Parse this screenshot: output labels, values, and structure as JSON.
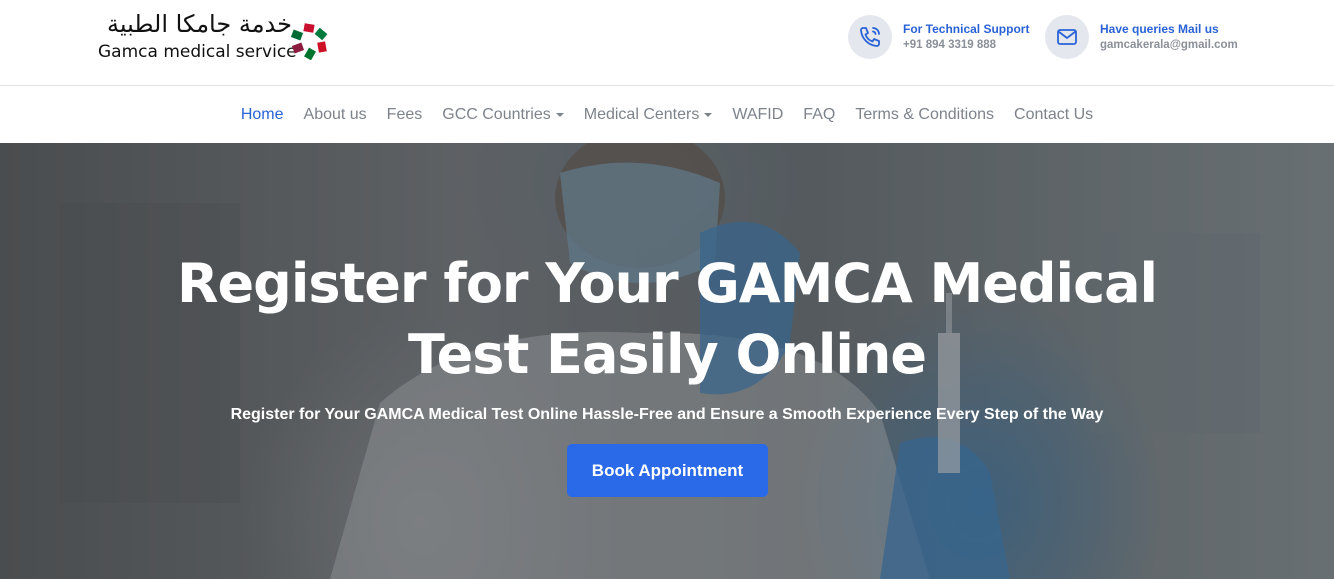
{
  "logo": {
    "arabic": "خدمة جامكا الطبية",
    "english": "Gamca medical service"
  },
  "contacts": {
    "phone": {
      "label": "For Technical Support",
      "value": "+91 894 3319 888",
      "icon": "phone-icon"
    },
    "mail": {
      "label": "Have queries Mail us",
      "value": "gamcakerala@gmail.com",
      "icon": "mail-icon"
    }
  },
  "nav": {
    "items": [
      {
        "label": "Home",
        "active": true
      },
      {
        "label": "About us"
      },
      {
        "label": "Fees"
      },
      {
        "label": "GCC Countries",
        "dropdown": true
      },
      {
        "label": "Medical Centers",
        "dropdown": true
      },
      {
        "label": "WAFID"
      },
      {
        "label": "FAQ"
      },
      {
        "label": "Terms & Conditions"
      },
      {
        "label": "Contact Us"
      }
    ]
  },
  "hero": {
    "title": "Register for Your GAMCA Medical Test Easily Online",
    "subtitle": "Register for Your GAMCA Medical Test Online Hassle-Free and Ensure a Smooth Experience Every Step of the Way",
    "button": "Book Appointment"
  },
  "colors": {
    "accent": "#2a63d6",
    "button": "#2a6ae8",
    "nav_text": "#7d838b"
  }
}
